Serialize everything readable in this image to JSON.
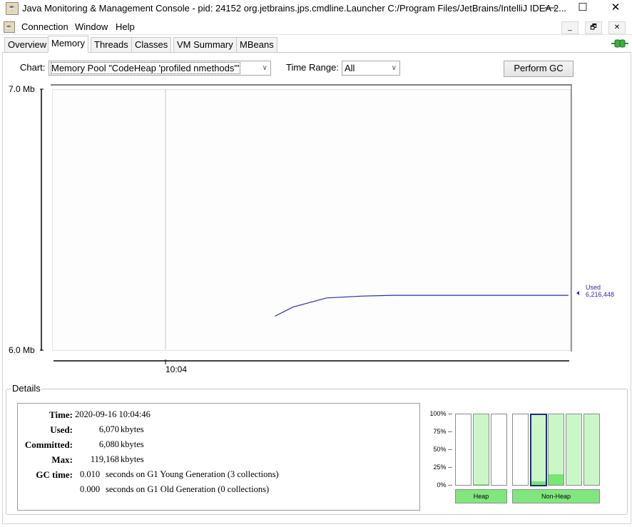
{
  "window": {
    "title": "Java Monitoring & Management Console - pid: 24152 org.jetbrains.jps.cmdline.Launcher C:/Program Files/JetBrains/IntelliJ IDEA 2...",
    "minimize": "—",
    "maximize": "☐",
    "close": "✕"
  },
  "menubar": {
    "items": [
      "Connection",
      "Window",
      "Help"
    ],
    "inner_buttons": [
      "_",
      "🗗",
      "✕"
    ]
  },
  "tabs": [
    "Overview",
    "Memory",
    "Threads",
    "Classes",
    "VM Summary",
    "MBeans"
  ],
  "active_tab": "Memory",
  "controls": {
    "chart_label": "Chart:",
    "chart_value": "Memory Pool \"CodeHeap 'profiled nmethods'\"",
    "time_range_label": "Time Range:",
    "time_range_value": "All",
    "perform_gc": "Perform GC"
  },
  "chart_data": {
    "type": "line",
    "ylabel": "",
    "ylim_labels": [
      "7.0 Mb",
      "6.0 Mb"
    ],
    "ylim": [
      6.0,
      7.0
    ],
    "x_tick_labels": [
      "10:04"
    ],
    "series": [
      {
        "name": "Used",
        "color": "#2a2aa8",
        "points_mb": [
          {
            "t": 0.43,
            "y": 6.13
          },
          {
            "t": 0.465,
            "y": 6.165
          },
          {
            "t": 0.53,
            "y": 6.2
          },
          {
            "t": 0.6,
            "y": 6.207
          },
          {
            "t": 0.66,
            "y": 6.21
          },
          {
            "t": 0.75,
            "y": 6.21
          },
          {
            "t": 0.85,
            "y": 6.21
          },
          {
            "t": 1.0,
            "y": 6.21
          }
        ]
      }
    ],
    "legend_label": "Used",
    "legend_value": "6,216,448"
  },
  "details": {
    "legend": "Details",
    "time_label": "Time:",
    "time_value": "2020-09-16 10:04:46",
    "used_label": "Used:",
    "used_value": "6,070",
    "committed_label": "Committed:",
    "committed_value": "6,080",
    "max_label": "Max:",
    "max_value": "119,168",
    "unit": "kbytes",
    "gc_label": "GC time:",
    "gc_young_value": "0.010",
    "gc_young_text": "seconds on G1 Young Generation (3 collections)",
    "gc_old_value": "0.000",
    "gc_old_text": "seconds on G1 Old Generation (0 collections)"
  },
  "memory_bars": {
    "pct_labels": [
      "100% --",
      "75% --",
      "50% --",
      "25% --",
      "0% --"
    ],
    "heap_label": "Heap",
    "nonheap_label": "Non-Heap",
    "heap": [
      {
        "committed": 0.0,
        "used": 0.0
      },
      {
        "committed": 1.0,
        "used": 0.01
      },
      {
        "committed": 0.0,
        "used": 0.0
      }
    ],
    "nonheap": [
      {
        "committed": 0.0,
        "used": 0.0
      },
      {
        "committed": 1.0,
        "used": 0.05,
        "selected": true
      },
      {
        "committed": 1.0,
        "used": 0.15
      },
      {
        "committed": 1.0,
        "used": 0.0
      },
      {
        "committed": 1.0,
        "used": 0.0
      }
    ]
  }
}
